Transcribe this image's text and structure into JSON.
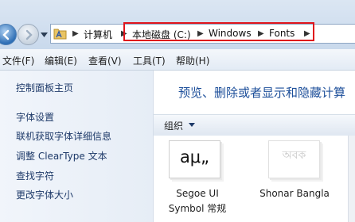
{
  "address_bar": {
    "crumbs": [
      "计算机",
      "本地磁盘 (C:)",
      "Windows",
      "Fonts"
    ]
  },
  "menu": {
    "items": [
      "文件(F)",
      "编辑(E)",
      "查看(V)",
      "工具(T)",
      "帮助(H)"
    ]
  },
  "sidebar": {
    "home": "控制面板主页",
    "links": [
      "字体设置",
      "联机获取字体详细信息",
      "调整 ClearType 文本",
      "查找字符",
      "更改字体大小"
    ]
  },
  "main": {
    "heading": "预览、删除或者显示和隐藏计算",
    "organize_label": "组织",
    "fonts": [
      {
        "preview": "aμ„",
        "name_line1": "Segoe UI",
        "name_line2": "Symbol 常规"
      },
      {
        "preview": "অবক",
        "name_line1": "Shonar Bangla",
        "name_line2": ""
      }
    ]
  },
  "colors": {
    "highlight_border": "#e0141c",
    "link": "#1e3a69",
    "heading": "#1d4f9a"
  }
}
